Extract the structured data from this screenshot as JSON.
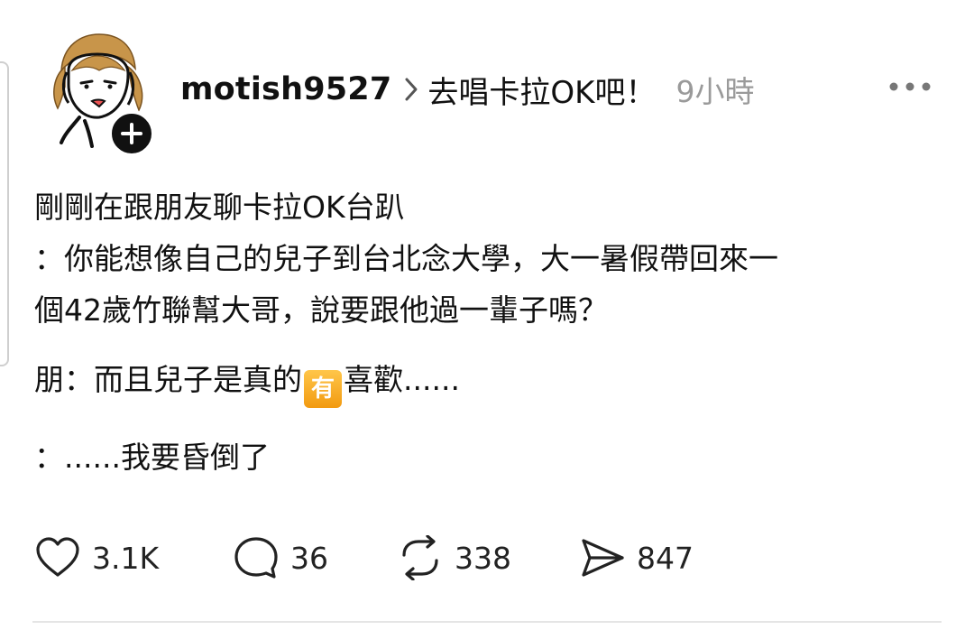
{
  "post": {
    "username": "motish9527",
    "community": "去唱卡拉OK吧！",
    "time": "9小時",
    "lines": {
      "l1": "剛剛在跟朋友聊卡拉OK台趴",
      "l2": "：你能想像自己的兒子到台北念大學，大一暑假帶回來一",
      "l3": "個42歲竹聯幫大哥，說要跟他過一輩子嗎？",
      "l4_before": "朋：而且兒子是真的",
      "l4_emoji": "有",
      "l4_after": "喜歡......",
      "l5": "：......我要昏倒了"
    }
  },
  "actions": {
    "likes": "3.1K",
    "replies": "36",
    "reposts": "338",
    "shares": "847"
  },
  "icons": {
    "avatar": "avatar-illustration",
    "follow": "plus-icon",
    "chevron": "chevron-right-icon",
    "more": "more-dots-icon",
    "like": "heart-icon",
    "reply": "comment-icon",
    "repost": "repost-icon",
    "share": "send-icon"
  },
  "colors": {
    "text": "#111111",
    "muted": "#9a9a9a",
    "emoji_badge": "#f5a623",
    "avatar_hair": "#c8954a"
  }
}
